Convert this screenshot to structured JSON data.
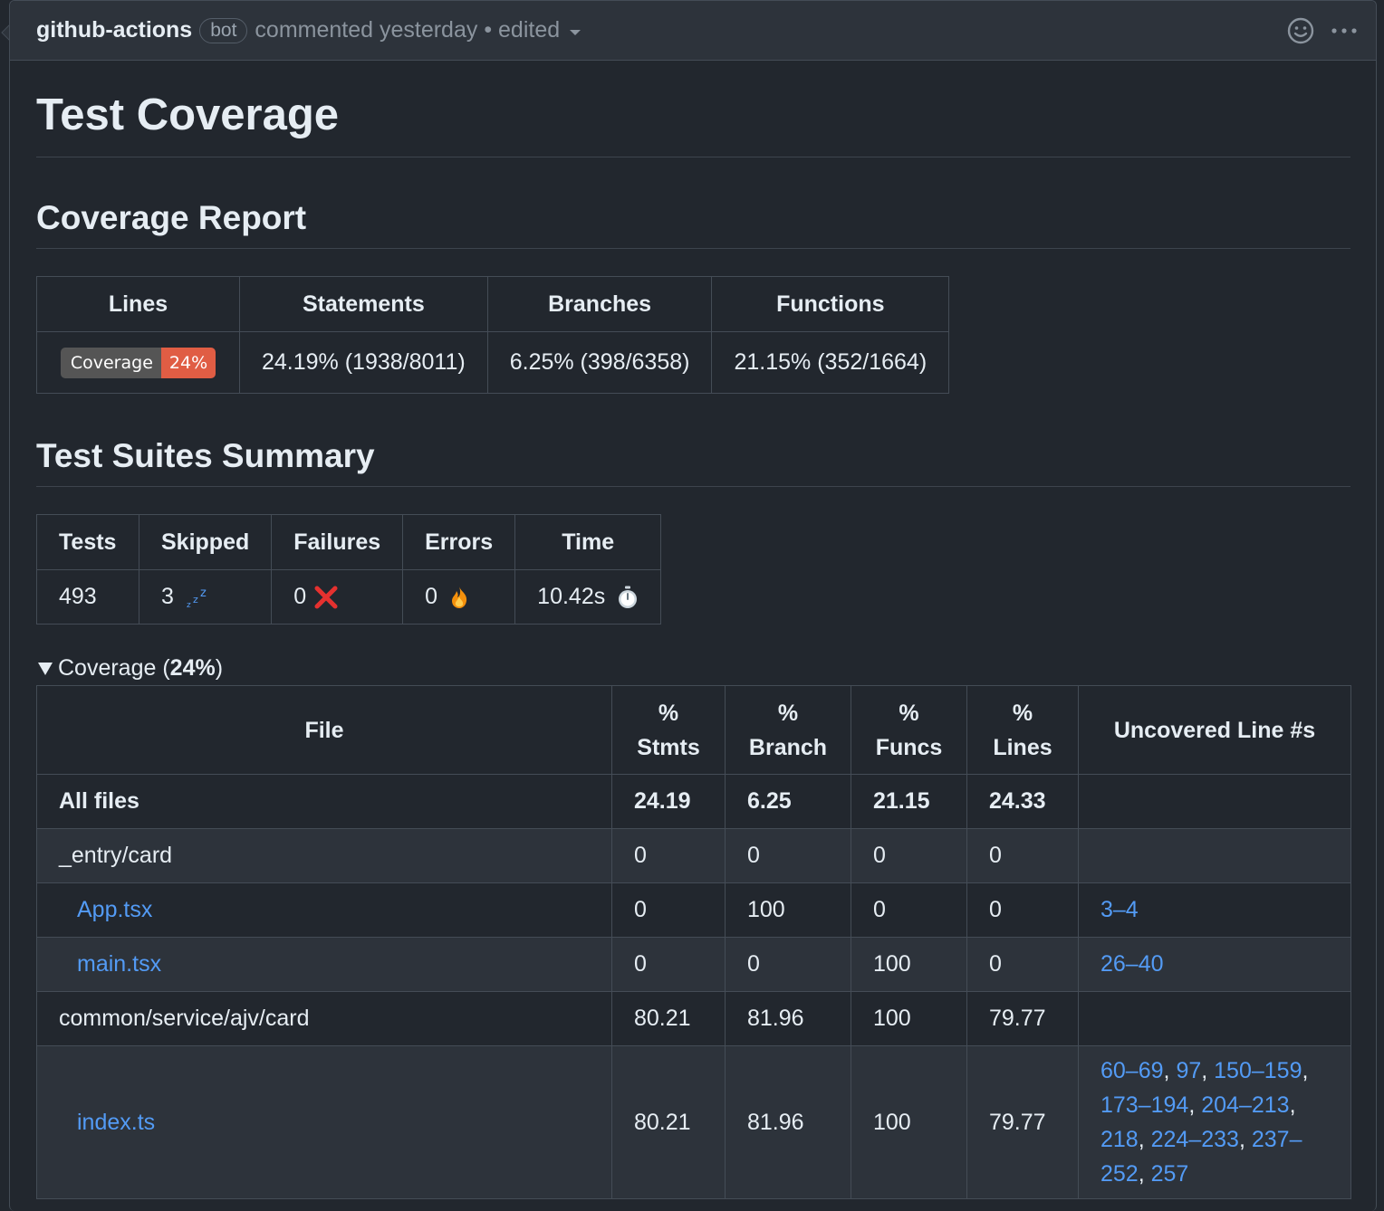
{
  "header": {
    "author": "github-actions",
    "badge": "bot",
    "meta": "commented yesterday • edited",
    "icons": [
      "smiley-icon",
      "kebab-menu-icon",
      "caret-down-icon"
    ]
  },
  "title": "Test Coverage",
  "coverage_report": {
    "heading": "Coverage Report",
    "columns": [
      "Lines",
      "Statements",
      "Branches",
      "Functions"
    ],
    "badge_label": "Coverage",
    "badge_value": "24%",
    "badge_color": "#e05d44",
    "statements": "24.19% (1938/8011)",
    "branches": "6.25% (398/6358)",
    "functions": "21.15% (352/1664)"
  },
  "test_suites": {
    "heading": "Test Suites Summary",
    "columns": [
      "Tests",
      "Skipped",
      "Failures",
      "Errors",
      "Time"
    ],
    "tests": "493",
    "skipped": "3",
    "failures": "0",
    "errors": "0",
    "time": "10.42s"
  },
  "coverage_details": {
    "summary_prefix": "Coverage (",
    "summary_value": "24%",
    "summary_suffix": ")",
    "columns": {
      "file": "File",
      "stmts_1": "%",
      "stmts_2": "Stmts",
      "branch_1": "%",
      "branch_2": "Branch",
      "funcs_1": "%",
      "funcs_2": "Funcs",
      "lines_1": "%",
      "lines_2": "Lines",
      "uncovered": "Uncovered Line #s"
    },
    "rows": [
      {
        "file": "All files",
        "stmts": "24.19",
        "branch": "6.25",
        "funcs": "21.15",
        "lines": "24.33",
        "uncovered": ""
      },
      {
        "file": "_entry/card",
        "stmts": "0",
        "branch": "0",
        "funcs": "0",
        "lines": "0",
        "uncovered": ""
      },
      {
        "file": "App.tsx",
        "stmts": "0",
        "branch": "100",
        "funcs": "0",
        "lines": "0",
        "uncovered": "3–4"
      },
      {
        "file": "main.tsx",
        "stmts": "0",
        "branch": "0",
        "funcs": "100",
        "lines": "0",
        "uncovered": "26–40"
      },
      {
        "file": "common/service/ajv/card",
        "stmts": "80.21",
        "branch": "81.96",
        "funcs": "100",
        "lines": "79.77",
        "uncovered": ""
      },
      {
        "file": "index.ts",
        "stmts": "80.21",
        "branch": "81.96",
        "funcs": "100",
        "lines": "79.77",
        "uncovered_links": [
          "60–69",
          "97",
          "150–159",
          "173–194",
          "204–213",
          "218",
          "224–233",
          "237–252",
          "257"
        ]
      }
    ]
  }
}
